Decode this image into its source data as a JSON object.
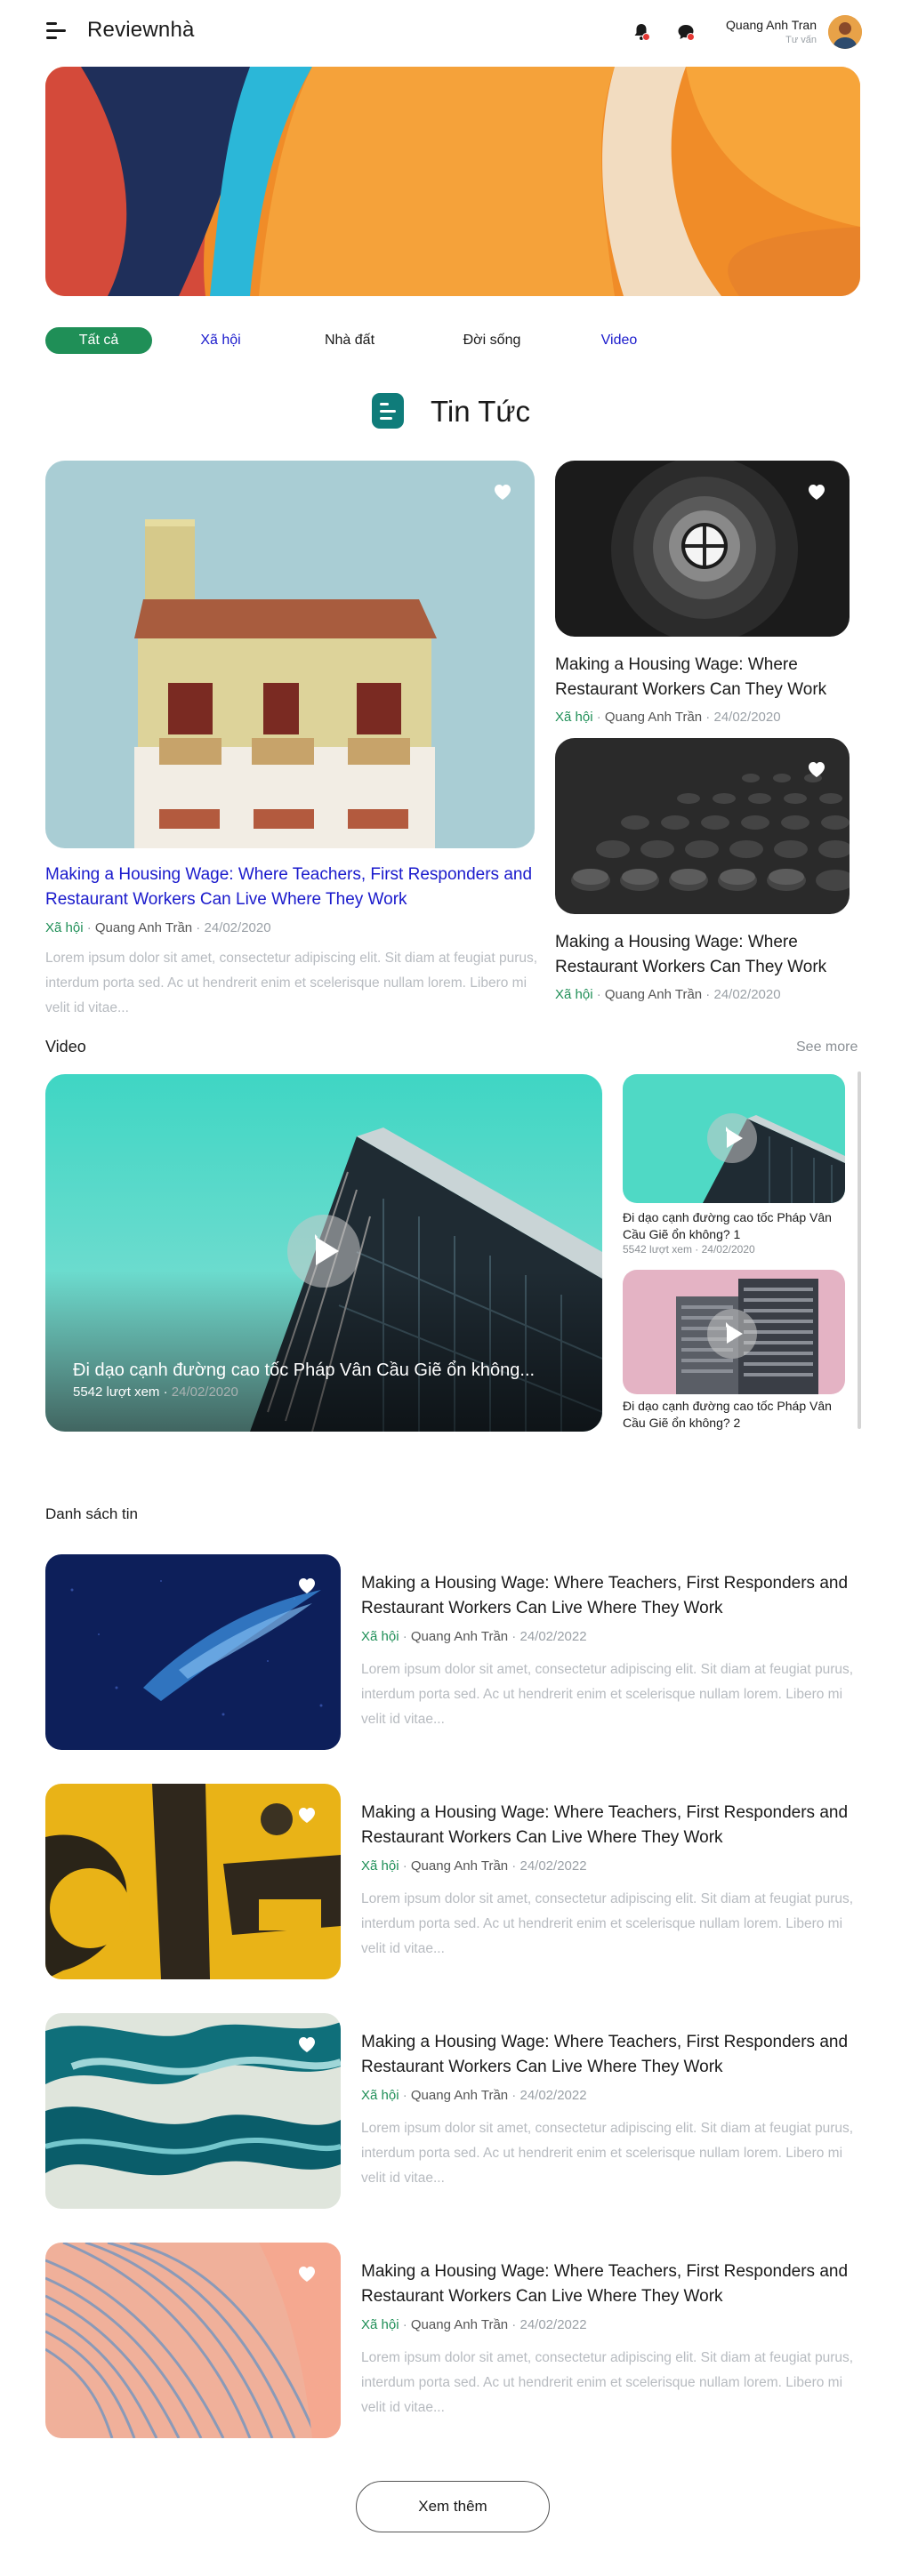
{
  "header": {
    "logo": "Reviewnhà",
    "user_name": "Quang Anh Tran",
    "user_role": "Tư vấn"
  },
  "tabs": [
    {
      "label": "Tất cả",
      "active": true
    },
    {
      "label": "Xã hội",
      "active": false
    },
    {
      "label": "Nhà đất",
      "active": false
    },
    {
      "label": "Đời sống",
      "active": false
    },
    {
      "label": "Video",
      "active": false
    }
  ],
  "news": {
    "section_title": "Tin Tức",
    "featured": {
      "title": "Making a Housing Wage: Where Teachers, First Responders and Restaurant Workers Can Live Where They Work",
      "category": "Xã hội",
      "author": "Quang Anh Trần",
      "date": "24/02/2020",
      "excerpt": "Lorem ipsum dolor sit amet, consectetur adipiscing elit. Sit diam at feugiat purus, interdum porta sed. Ac ut hendrerit enim et scelerisque nullam lorem. Libero mi velit id vitae..."
    },
    "side": [
      {
        "title": "Making a Housing Wage: Where Restaurant Workers Can They Work",
        "category": "Xã hội",
        "author": "Quang Anh Trần",
        "date": "24/02/2020"
      },
      {
        "title": "Making a Housing Wage: Where Restaurant Workers Can They Work",
        "category": "Xã hội",
        "author": "Quang Anh Trần",
        "date": "24/02/2020"
      }
    ]
  },
  "video": {
    "label": "Video",
    "see_more": "See more",
    "main": {
      "title": "Đi dạo cạnh đường cao tốc Pháp Vân Cầu Giẽ ổn không...",
      "views": "5542 lượt xem",
      "date": "24/02/2020"
    },
    "side": [
      {
        "title": "Đi dạo cạnh đường cao tốc Pháp Vân Cầu Giẽ ổn không? 1",
        "views": "5542 lượt xem",
        "date": "24/02/2020"
      },
      {
        "title": "Đi dạo cạnh đường cao tốc Pháp Vân Cầu Giẽ ổn không? 2"
      }
    ]
  },
  "list": {
    "label": "Danh sách tin",
    "items": [
      {
        "title": "Making a Housing Wage: Where Teachers, First Responders and Restaurant Workers Can Live Where They Work",
        "category": "Xã hội",
        "author": "Quang Anh Trần",
        "date": "24/02/2022",
        "excerpt": "Lorem ipsum dolor sit amet, consectetur adipiscing elit. Sit diam at feugiat purus, interdum porta sed. Ac ut hendrerit enim et scelerisque nullam lorem. Libero mi velit id vitae..."
      },
      {
        "title": "Making a Housing Wage: Where Teachers, First Responders and Restaurant Workers Can Live Where They Work",
        "category": "Xã hội",
        "author": "Quang Anh Trần",
        "date": "24/02/2022",
        "excerpt": "Lorem ipsum dolor sit amet, consectetur adipiscing elit. Sit diam at feugiat purus, interdum porta sed. Ac ut hendrerit enim et scelerisque nullam lorem. Libero mi velit id vitae..."
      },
      {
        "title": "Making a Housing Wage: Where Teachers, First Responders and Restaurant Workers Can Live Where They Work",
        "category": "Xã hội",
        "author": "Quang Anh Trần",
        "date": "24/02/2022",
        "excerpt": "Lorem ipsum dolor sit amet, consectetur adipiscing elit. Sit diam at feugiat purus, interdum porta sed. Ac ut hendrerit enim et scelerisque nullam lorem. Libero mi velit id vitae..."
      },
      {
        "title": "Making a Housing Wage: Where Teachers, First Responders and Restaurant Workers Can Live Where They Work",
        "category": "Xã hội",
        "author": "Quang Anh Trần",
        "date": "24/02/2022",
        "excerpt": "Lorem ipsum dolor sit amet, consectetur adipiscing elit. Sit diam at feugiat purus, interdum porta sed. Ac ut hendrerit enim et scelerisque nullam lorem. Libero mi velit id vitae..."
      }
    ],
    "more_button": "Xem thêm"
  }
}
